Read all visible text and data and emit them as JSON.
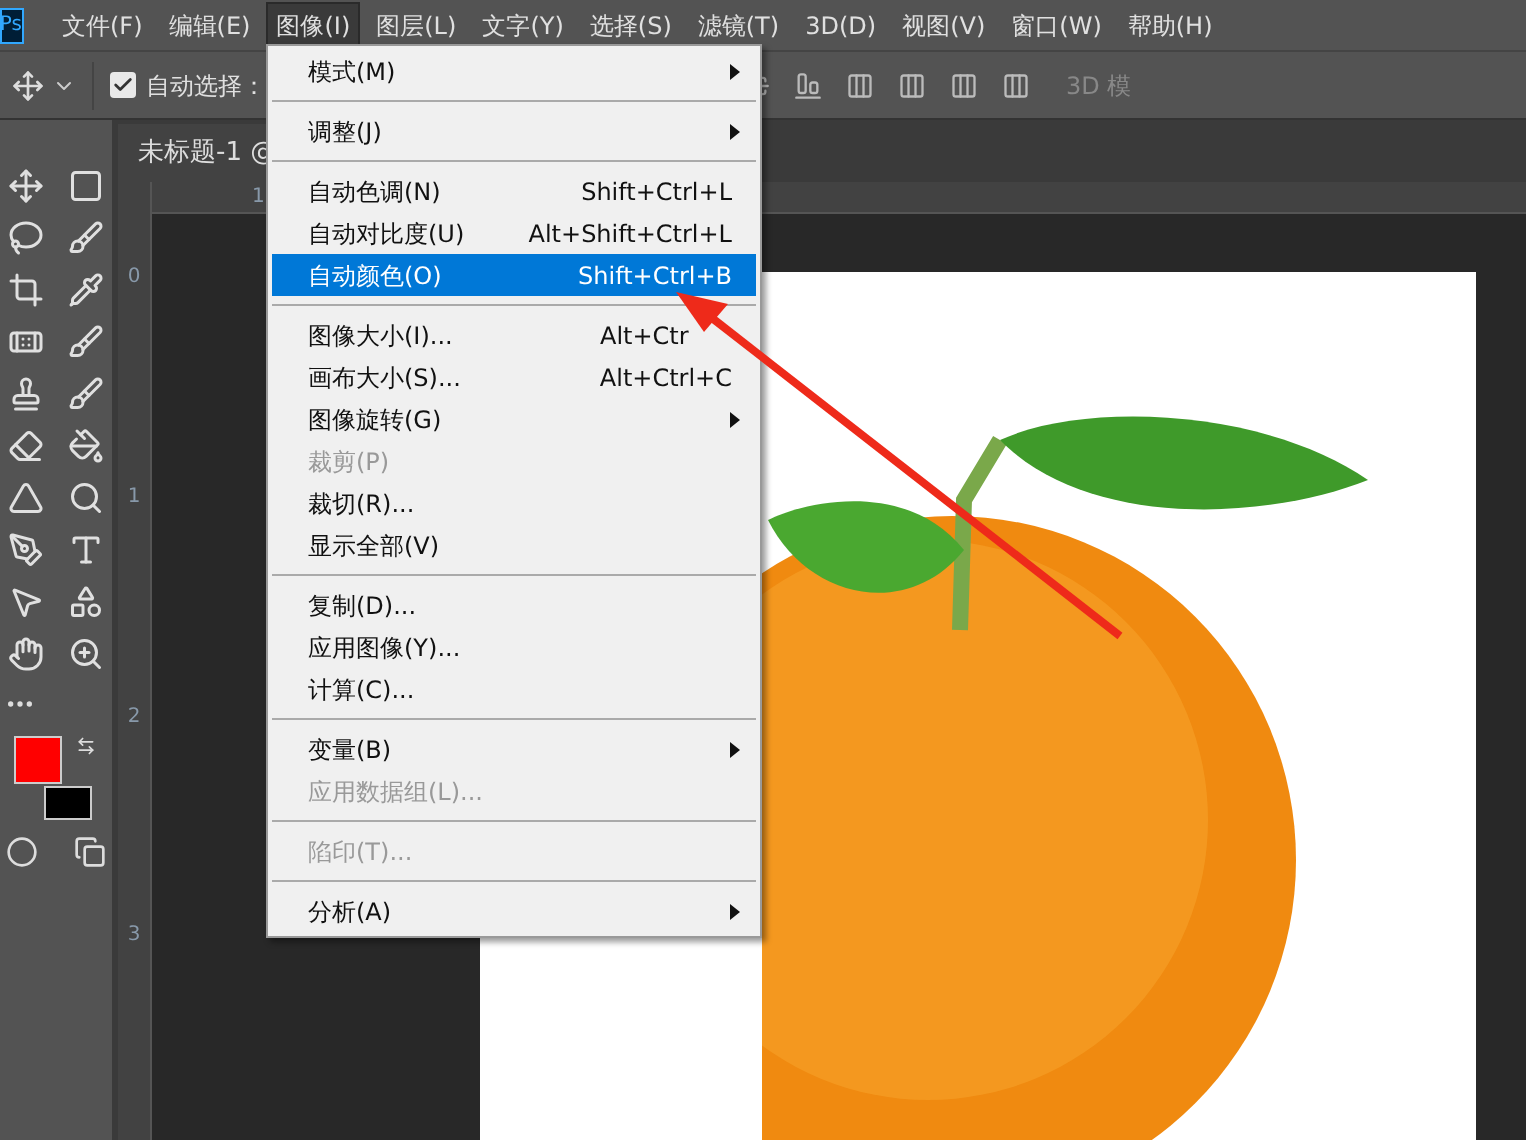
{
  "app_logo": "Ps",
  "menu_bar": [
    {
      "label": "文件(F)",
      "selected": false
    },
    {
      "label": "编辑(E)",
      "selected": false
    },
    {
      "label": "图像(I)",
      "selected": true
    },
    {
      "label": "图层(L)",
      "selected": false
    },
    {
      "label": "文字(Y)",
      "selected": false
    },
    {
      "label": "选择(S)",
      "selected": false
    },
    {
      "label": "滤镜(T)",
      "selected": false
    },
    {
      "label": "3D(D)",
      "selected": false
    },
    {
      "label": "视图(V)",
      "selected": false
    },
    {
      "label": "窗口(W)",
      "selected": false
    },
    {
      "label": "帮助(H)",
      "selected": false
    }
  ],
  "options_bar": {
    "auto_select": {
      "label": "自动选择：",
      "checked": true
    },
    "trailing_text": "3D 模"
  },
  "document_tab": {
    "title": "未标题-1 @"
  },
  "rulers": {
    "horizontal": [
      "1"
    ],
    "vertical": [
      "0",
      "1",
      "2",
      "3"
    ]
  },
  "color_swatches": [
    {
      "kind": "foreground",
      "color": "#ff0000"
    },
    {
      "kind": "background",
      "color": "#000000"
    }
  ],
  "dropdown_menu": [
    {
      "kind": "item",
      "label": "模式(M)",
      "submenu": true,
      "disabled": false,
      "selected": false
    },
    {
      "kind": "separator"
    },
    {
      "kind": "item",
      "label": "调整(J)",
      "submenu": true,
      "disabled": false,
      "selected": false
    },
    {
      "kind": "separator"
    },
    {
      "kind": "item",
      "label": "自动色调(N)",
      "shortcut": "Shift+Ctrl+L",
      "submenu": false,
      "disabled": false,
      "selected": false
    },
    {
      "kind": "item",
      "label": "自动对比度(U)",
      "shortcut": "Alt+Shift+Ctrl+L",
      "submenu": false,
      "disabled": false,
      "selected": false
    },
    {
      "kind": "item",
      "label": "自动颜色(O)",
      "shortcut": "Shift+Ctrl+B",
      "submenu": false,
      "disabled": false,
      "selected": true
    },
    {
      "kind": "separator"
    },
    {
      "kind": "item",
      "label": "图像大小(I)...",
      "shortcut": "Alt+Ctr",
      "submenu": false,
      "disabled": false,
      "selected": false
    },
    {
      "kind": "item",
      "label": "画布大小(S)...",
      "shortcut": "Alt+Ctrl+C",
      "submenu": false,
      "disabled": false,
      "selected": false
    },
    {
      "kind": "item",
      "label": "图像旋转(G)",
      "submenu": true,
      "disabled": false,
      "selected": false
    },
    {
      "kind": "item",
      "label": "裁剪(P)",
      "submenu": false,
      "disabled": true,
      "selected": false
    },
    {
      "kind": "item",
      "label": "裁切(R)...",
      "submenu": false,
      "disabled": false,
      "selected": false
    },
    {
      "kind": "item",
      "label": "显示全部(V)",
      "submenu": false,
      "disabled": false,
      "selected": false
    },
    {
      "kind": "separator"
    },
    {
      "kind": "item",
      "label": "复制(D)...",
      "submenu": false,
      "disabled": false,
      "selected": false
    },
    {
      "kind": "item",
      "label": "应用图像(Y)...",
      "submenu": false,
      "disabled": false,
      "selected": false
    },
    {
      "kind": "item",
      "label": "计算(C)...",
      "submenu": false,
      "disabled": false,
      "selected": false
    },
    {
      "kind": "separator"
    },
    {
      "kind": "item",
      "label": "变量(B)",
      "submenu": true,
      "disabled": false,
      "selected": false
    },
    {
      "kind": "item",
      "label": "应用数据组(L)...",
      "submenu": false,
      "disabled": true,
      "selected": false
    },
    {
      "kind": "separator"
    },
    {
      "kind": "item",
      "label": "陷印(T)...",
      "submenu": false,
      "disabled": true,
      "selected": false
    },
    {
      "kind": "separator"
    },
    {
      "kind": "item",
      "label": "分析(A)",
      "submenu": true,
      "disabled": false,
      "selected": false
    }
  ]
}
